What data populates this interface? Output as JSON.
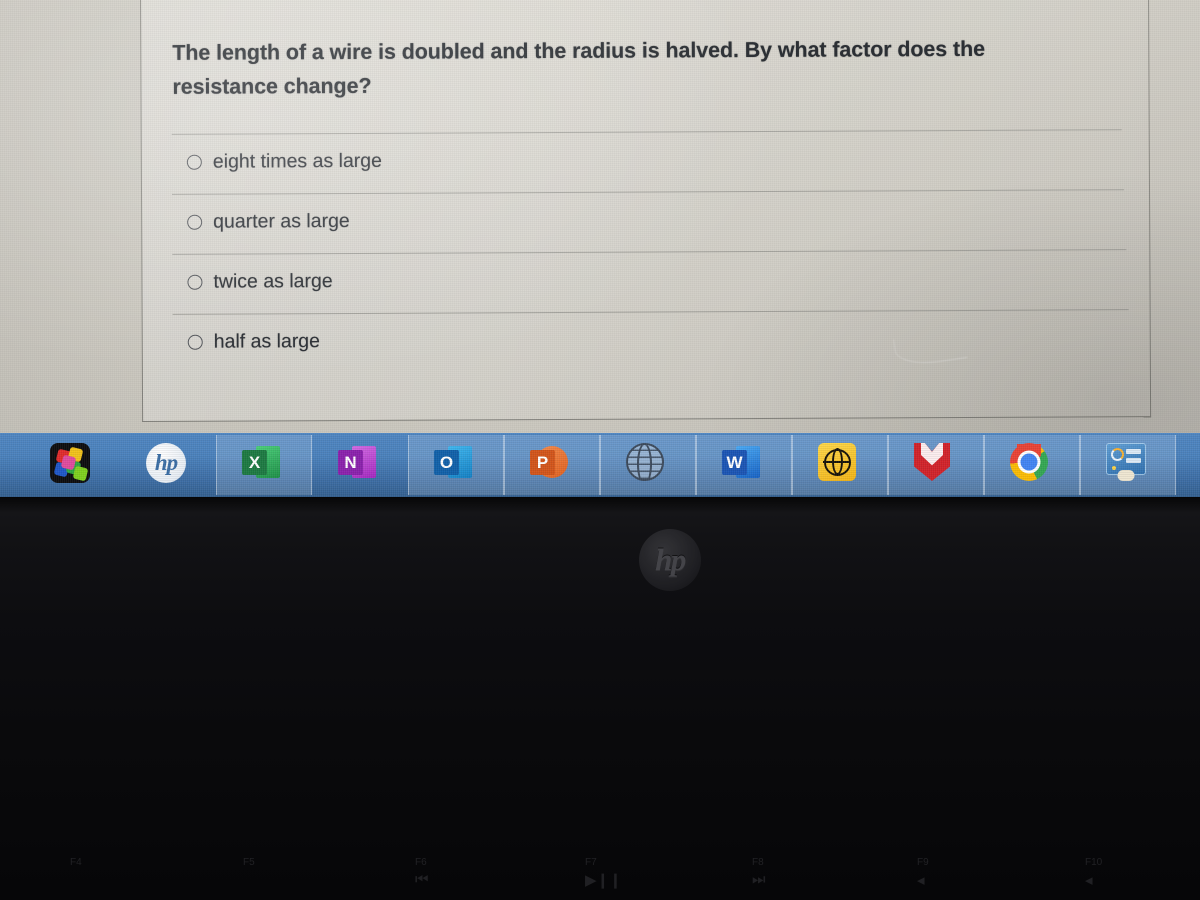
{
  "question": {
    "text": "The length of a wire is doubled and the radius is halved. By what factor does the resistance change?",
    "options": [
      {
        "label": "eight times as large",
        "selected": false
      },
      {
        "label": "quarter as large",
        "selected": false
      },
      {
        "label": "twice as large",
        "selected": false
      },
      {
        "label": "half as large",
        "selected": false
      }
    ]
  },
  "taskbar": {
    "accent_color": "#4b82bd",
    "items": [
      {
        "name": "puzzle-app-icon",
        "label": ""
      },
      {
        "name": "hp-logo-icon",
        "label": "hp"
      },
      {
        "name": "excel-icon",
        "label": "X"
      },
      {
        "name": "onenote-icon",
        "label": "N"
      },
      {
        "name": "outlook-icon",
        "label": "O"
      },
      {
        "name": "powerpoint-icon",
        "label": "P"
      },
      {
        "name": "globe-dark-icon",
        "label": ""
      },
      {
        "name": "word-icon",
        "label": "W"
      },
      {
        "name": "globe-yellow-icon",
        "label": ""
      },
      {
        "name": "mcafee-icon",
        "label": ""
      },
      {
        "name": "chrome-icon",
        "label": ""
      },
      {
        "name": "dashboard-widget-icon",
        "label": ""
      },
      {
        "name": "red-app-partial-icon",
        "label": ""
      }
    ]
  },
  "laptop": {
    "brand_logo": "hp",
    "function_keys": [
      {
        "label": "F4",
        "symbol": ""
      },
      {
        "label": "F5",
        "symbol": ""
      },
      {
        "label": "F6",
        "symbol": "⏮"
      },
      {
        "label": "F7",
        "symbol": "▶❙❙"
      },
      {
        "label": "F8",
        "symbol": "⏭"
      },
      {
        "label": "F9",
        "symbol": "◂"
      },
      {
        "label": "F10",
        "symbol": "◂"
      }
    ]
  }
}
